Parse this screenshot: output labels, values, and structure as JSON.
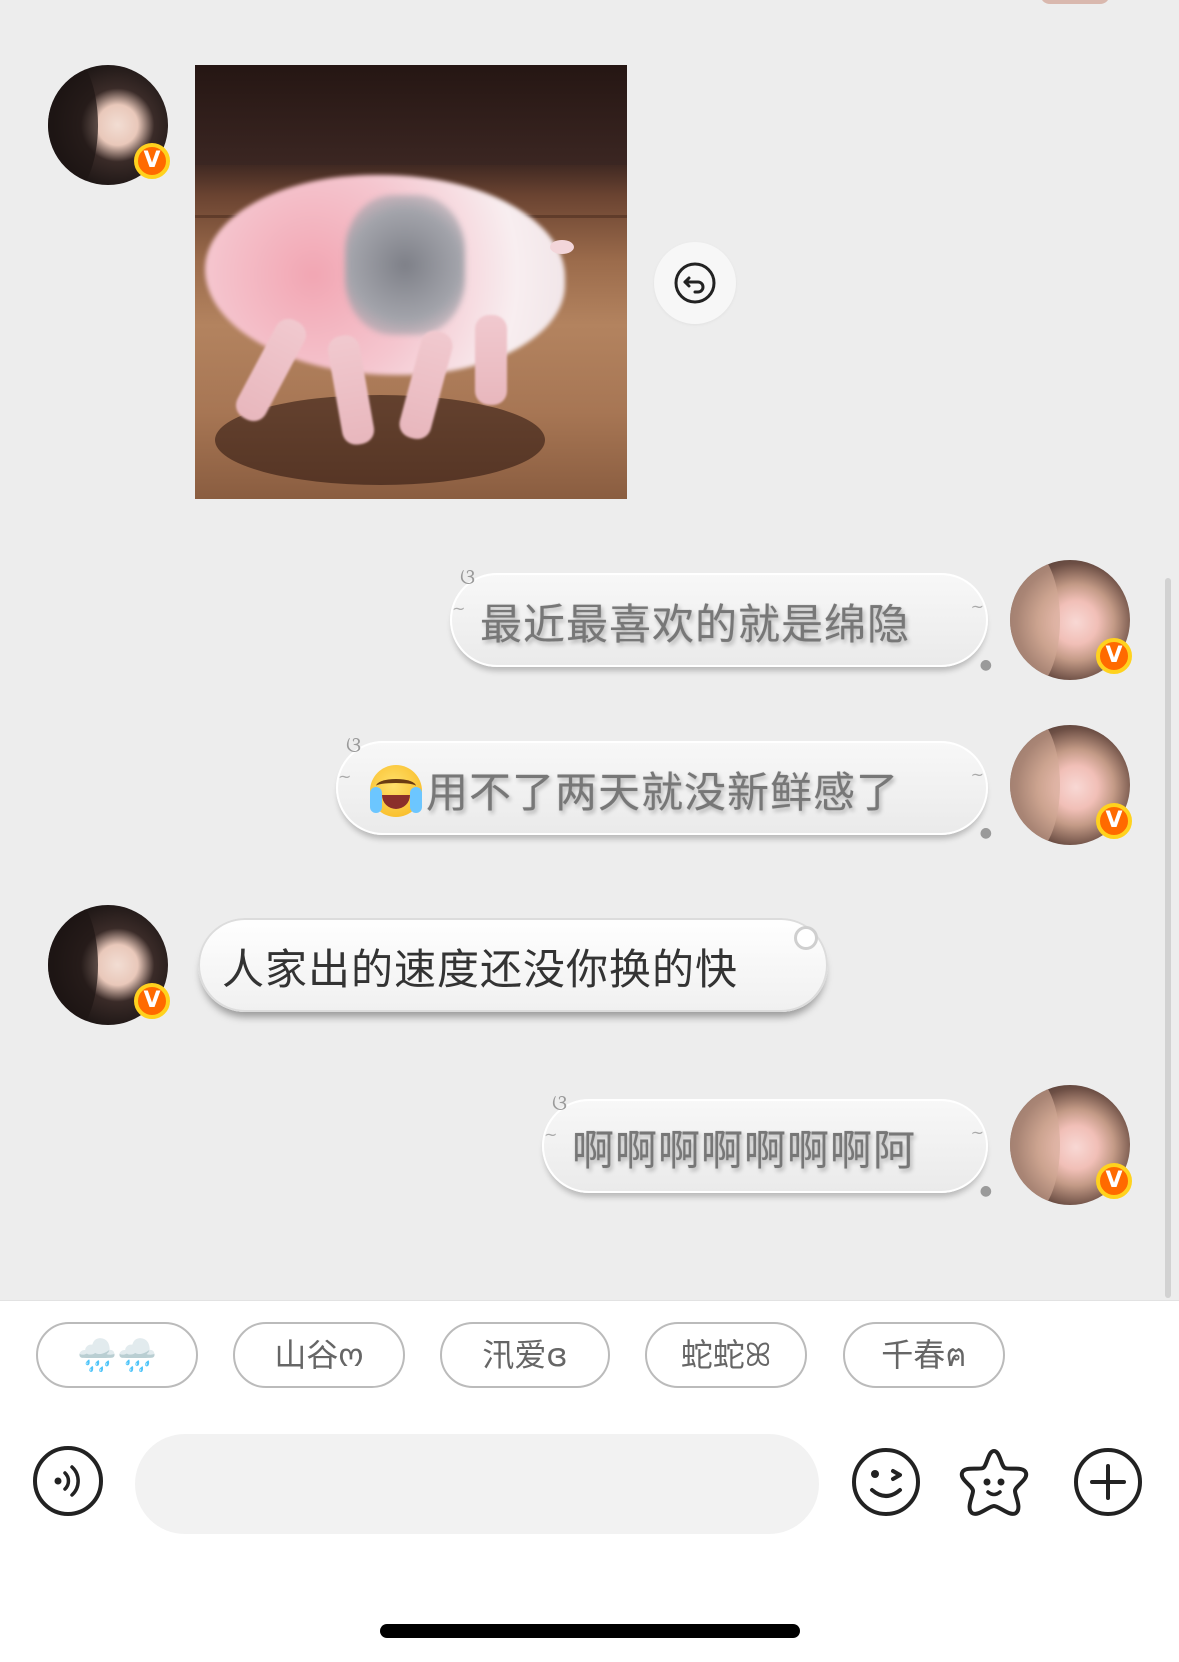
{
  "messages": {
    "m1_type": "image",
    "m2_text": "最近最喜欢的就是绵隐",
    "m3_text": "用不了两天就没新鲜感了",
    "m4_text": "人家出的速度还没你换的快",
    "m5_text": "啊啊啊啊啊啊啊阿"
  },
  "badge": {
    "label": "V",
    "color": "#ff6a00",
    "ring_color": "#ffd21e"
  },
  "quick_chips": [
    "🌧️🌧️",
    "山谷ო",
    "汛爱ɞ",
    "蛇蛇ꕤ",
    "千春ฅ"
  ],
  "input": {
    "value": "",
    "placeholder": ""
  },
  "icons": {
    "reply": "reply-arrow-icon",
    "voice": "voice-icon",
    "emoji": "wink-emoji-icon",
    "sticker": "star-face-icon",
    "more": "plus-icon"
  },
  "colors": {
    "chat_background": "#ededed",
    "panel_background": "#ffffff",
    "bubble_text": "#777777"
  }
}
